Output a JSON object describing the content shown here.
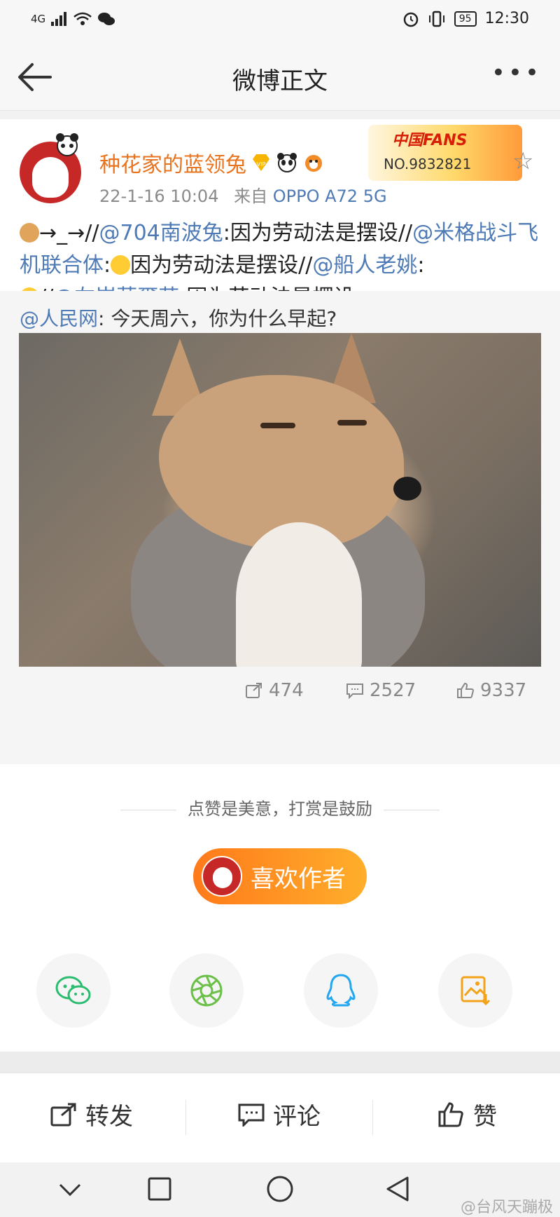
{
  "status_bar": {
    "signal": "4G",
    "battery": "95",
    "time": "12:30"
  },
  "nav": {
    "title": "微博正文",
    "more_icon": "more-dots-icon",
    "back_icon": "back-arrow-icon"
  },
  "post": {
    "username": "种花家的蓝领兔",
    "time": "22-1-16 10:04",
    "source_prefix": "来自",
    "source": "OPPO A72 5G",
    "fans_badge": {
      "title": "中国FANS",
      "number": "NO.9832821"
    },
    "body_segments": [
      {
        "t": "→_→//",
        "m": false
      },
      {
        "t": "@704南波兔",
        "m": true
      },
      {
        "t": ":因为劳动法是摆设//",
        "m": false
      },
      {
        "t": "@米格战斗飞机联合体",
        "m": true
      },
      {
        "t": ":",
        "m": false
      },
      {
        "t": "因为劳动法是摆设//",
        "m": false
      },
      {
        "t": "@船人老姚",
        "m": true
      },
      {
        "t": ":",
        "m": false
      },
      {
        "t": "//",
        "m": false
      },
      {
        "t": "@左岸華爾茲",
        "m": true
      },
      {
        "t": ":因为劳动法是摆设",
        "m": false
      }
    ]
  },
  "retweet": {
    "author": "@人民网",
    "text": ": 今天周六，你为什么早起?",
    "image_alt": "fox"
  },
  "stats": {
    "reposts": "474",
    "comments": "2527",
    "likes": "9337"
  },
  "reward": {
    "slogan": "点赞是美意，打赏是鼓励",
    "button_label": "喜欢作者"
  },
  "share_icons": [
    "wechat-icon",
    "moments-icon",
    "qq-icon",
    "save-image-icon"
  ],
  "actions": {
    "repost": "转发",
    "comment": "评论",
    "like": "赞"
  },
  "watermark": "@台风天蹦极",
  "colors": {
    "orange": "#e8741f",
    "link": "#4e7ab5"
  }
}
